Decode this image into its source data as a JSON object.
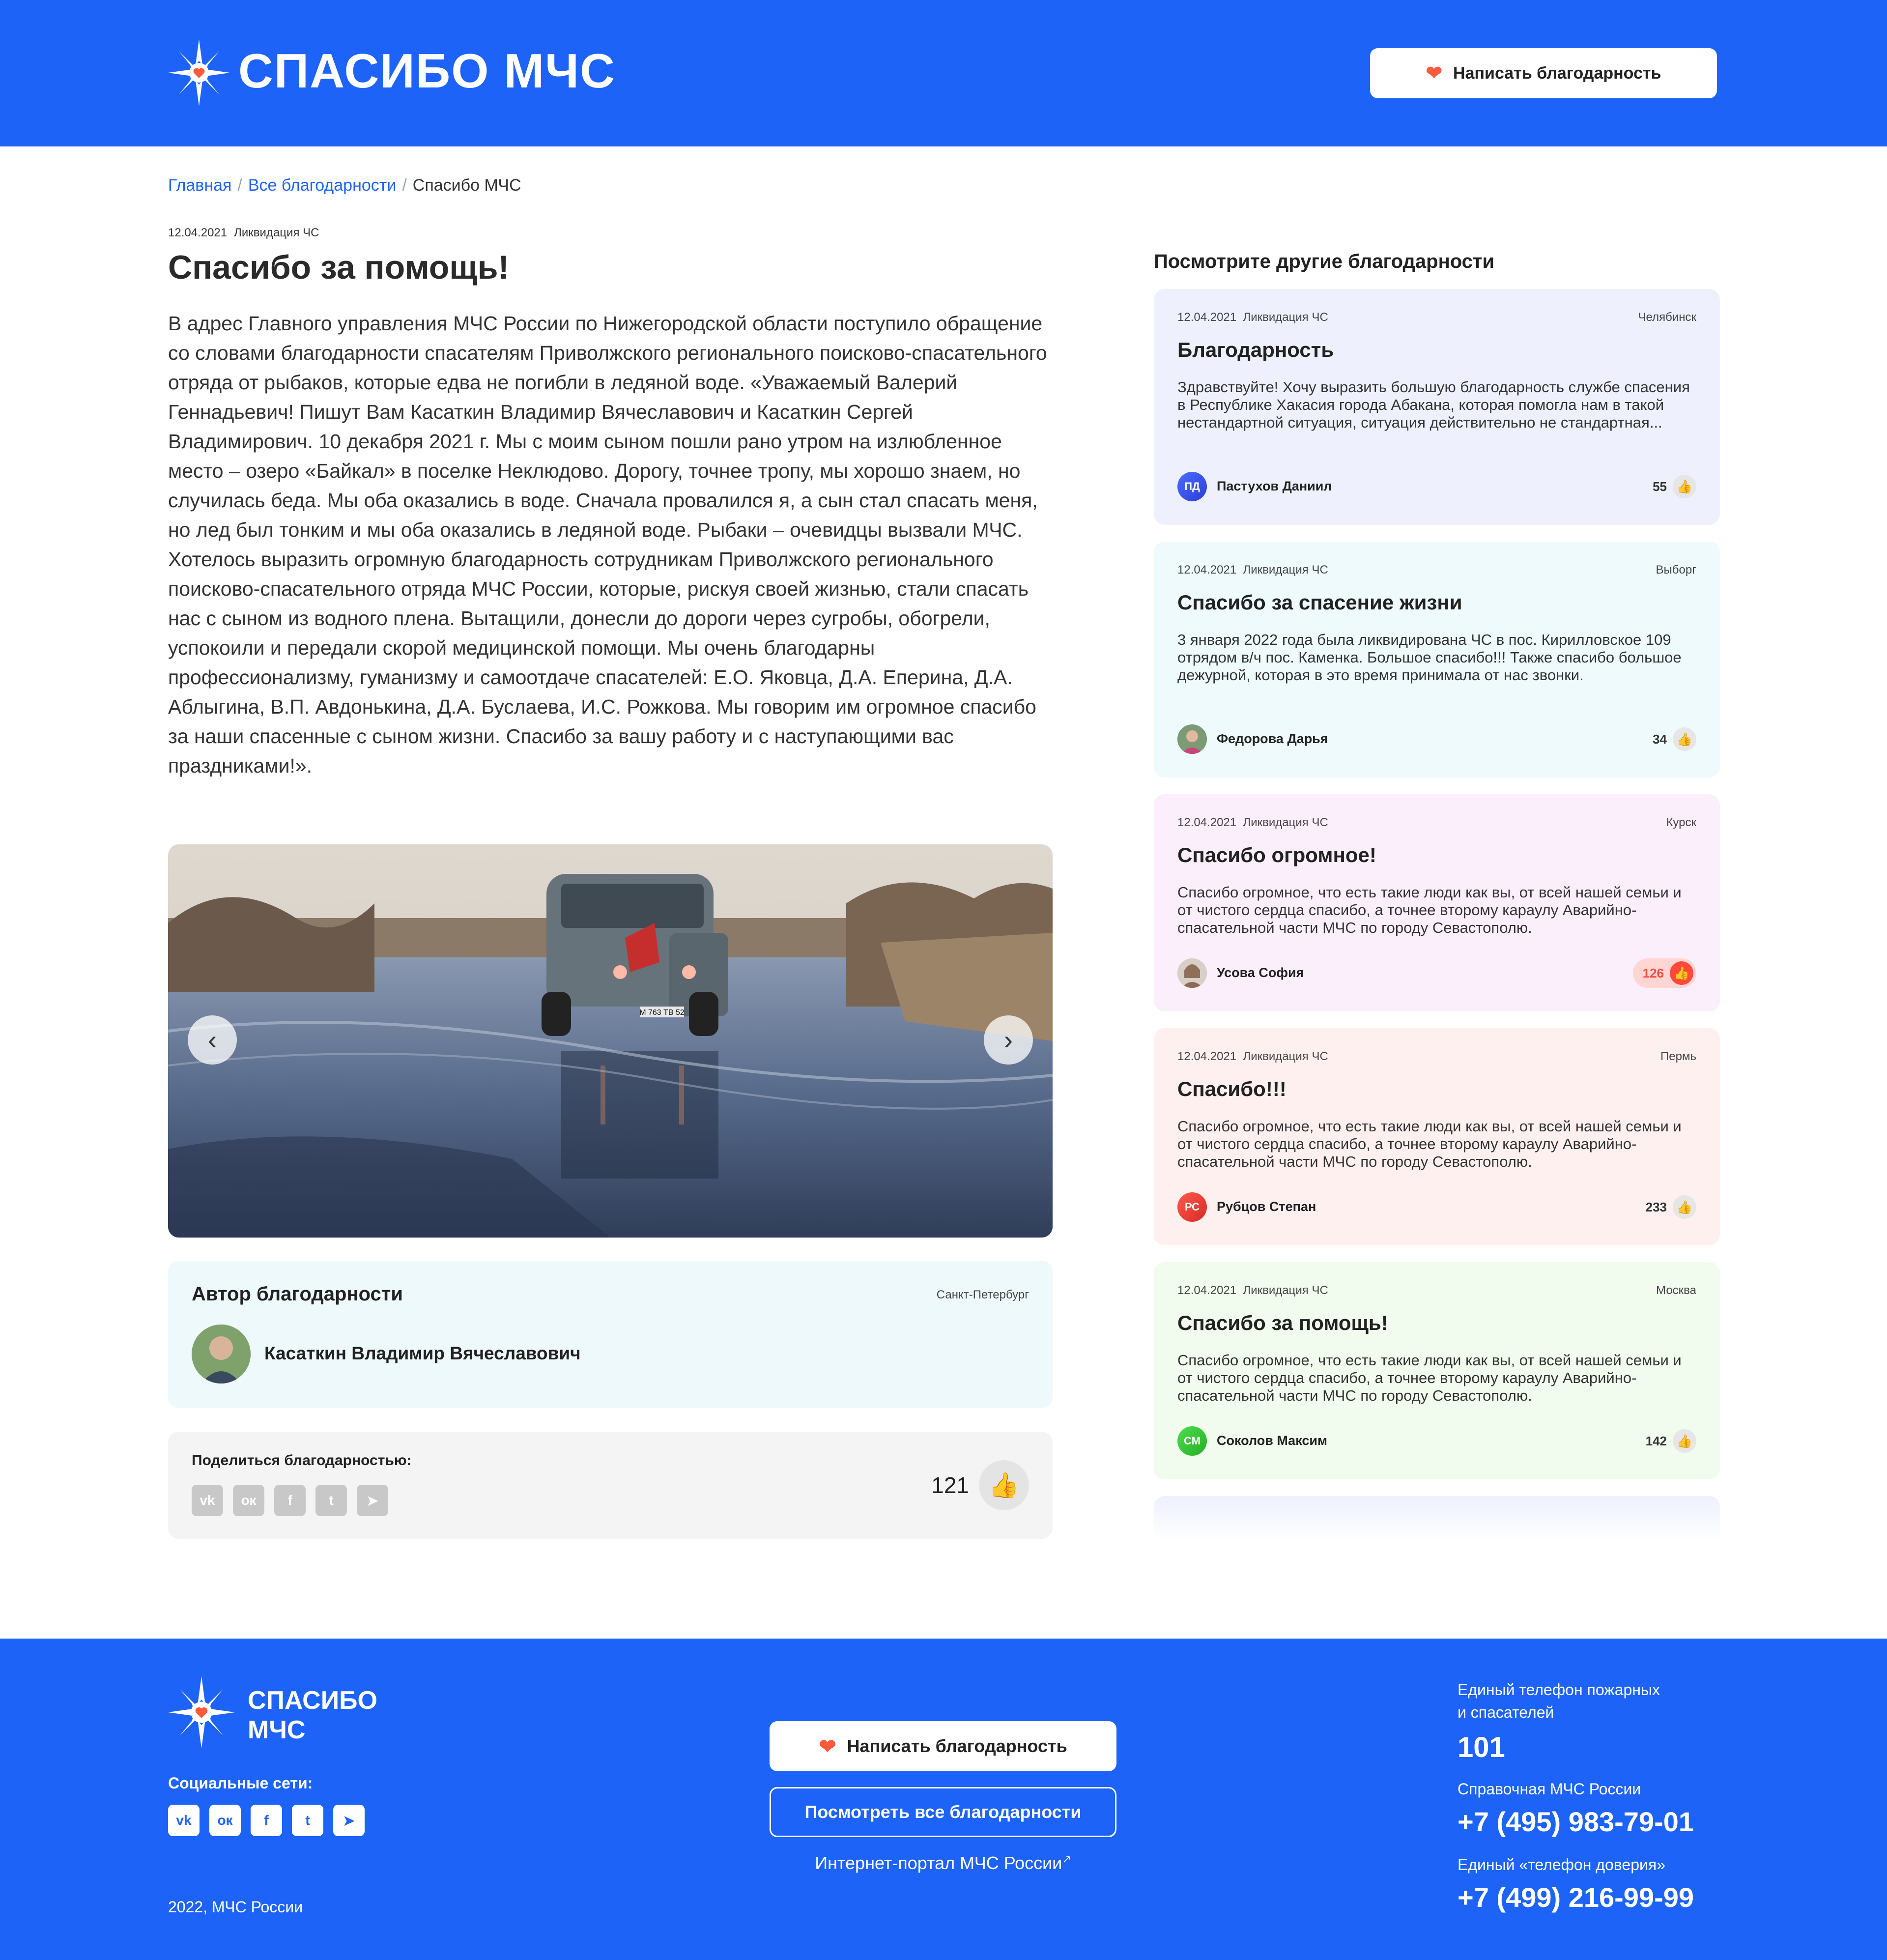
{
  "header": {
    "logo_text": "СПАСИБО МЧС",
    "write_button": "Написать благодарность",
    "heart": "❤"
  },
  "breadcrumb": {
    "home": "Главная",
    "all": "Все благодарности",
    "current": "Спасибо МЧС",
    "separator": "/"
  },
  "article": {
    "date": "12.04.2021",
    "category": "Ликвидация ЧС",
    "title": "Спасибо за помощь!",
    "body": "В адрес Главного управления МЧС России по Нижегородской области поступило обращение со словами благодарности спасателям Приволжского регионального поисково-спасательного отряда от рыбаков, которые едва не погибли в ледяной воде. «Уважаемый Валерий Геннадьевич! Пишут Вам Касаткин Владимир Вячеславович и Касаткин Сергей Владимирович. 10 декабря 2021 г. Мы с моим сыном пошли рано утром на излюбленное место – озеро «Байкал» в поселке Неклюдово. Дорогу, точнее тропу, мы хорошо знаем, но случилась беда. Мы оба оказались в воде. Сначала провалился я, а сын стал спасать меня, но лед был тонким и мы оба оказались в ледяной воде. Рыбаки – очевидцы вызвали МЧС. Хотелось выразить огромную благодарность сотрудникам Приволжского регионального поисково-спасательного отряда МЧС России, которые, рискуя своей жизнью, стали спасать нас с сыном из водного плена. Вытащили, донесли до дороги через сугробы, обогрели, успокоили и передали скорой медицинской помощи. Мы очень благодарны профессионализму, гуманизму и самоотдаче спасателей: Е.О. Яковца, Д.А. Еперина, Д.А. Аблыгина, В.П. Авдонькина, Д.А. Буслаева, И.С. Рожкова. Мы говорим им огромное спасибо за наши спасенные с сыном жизни. Спасибо за вашу работу и с наступающими вас праздниками!».",
    "photo_plate": "М 763 ТВ 52"
  },
  "author": {
    "heading": "Автор благодарности",
    "city": "Санкт-Петербург",
    "name": "Касаткин Владимир Вячеславович"
  },
  "share": {
    "label": "Поделиться благодарностью:",
    "likes": "121",
    "networks": [
      "vk",
      "ok",
      "facebook",
      "twitter",
      "telegram"
    ]
  },
  "sidebar": {
    "title": "Посмотрите другие благодарности",
    "cards": [
      {
        "date": "12.04.2021",
        "category": "Ликвидация ЧС",
        "city": "Челябинск",
        "title": "Благодарность",
        "text": "Здравствуйте! Хочу выразить большую благодарность службе спасения в Республике Хакасия города Абакана, которая помогла нам в такой нестандартной ситуация, ситуация действительно не стандартная...",
        "initials": "ПД",
        "name": "Пастухов Даниил",
        "likes": "55",
        "bg": "#eef1fd"
      },
      {
        "date": "12.04.2021",
        "category": "Ликвидация ЧС",
        "city": "Выборг",
        "title": "Спасибо за спасение жизни",
        "text": "3 января 2022 года была ликвидирована ЧС в пос. Кирилловское 109 отрядом в/ч пос. Каменка. Большое спасибо!!! Также спасибо большое дежурной, которая в это время принимала от нас звонки.",
        "initials": "",
        "name": "Федорова Дарья",
        "likes": "34",
        "bg": "#eefafb"
      },
      {
        "date": "12.04.2021",
        "category": "Ликвидация ЧС",
        "city": "Курск",
        "title": "Спасибо огромное!",
        "text": "Спасибо огромное, что есть такие люди как вы, от всей нашей семьи и от чистого сердца спасибо, а точнее второму караулу Аварийно-спасательной части МЧС по городу Севастополю.",
        "initials": "",
        "name": "Усова София",
        "likes": "126",
        "bg": "#fbeffc"
      },
      {
        "date": "12.04.2021",
        "category": "Ликвидация ЧС",
        "city": "Пермь",
        "title": "Спасибо!!!",
        "text": "Спасибо огромное, что есть такие люди как вы, от всей нашей семьи и от чистого сердца спасибо, а точнее второму караулу Аварийно-спасательной части МЧС по городу Севастополю.",
        "initials": "РС",
        "name": "Рубцов Степан",
        "likes": "233",
        "bg": "#fdf0ef"
      },
      {
        "date": "12.04.2021",
        "category": "Ликвидация ЧС",
        "city": "Москва",
        "title": "Спасибо за помощь!",
        "text": "Спасибо огромное, что есть такие люди как вы, от всей нашей семьи и от чистого сердца спасибо, а точнее второму караулу Аварийно-спасательной части МЧС по городу Севастополю.",
        "initials": "СМ",
        "name": "Соколов Максим",
        "likes": "142",
        "bg": "#f1fbee"
      }
    ]
  },
  "footer": {
    "logo_line1": "СПАСИБО",
    "logo_line2": "МЧС",
    "social_label": "Социальные сети:",
    "copyright": "2022, МЧС России",
    "write_button": "Написать благодарность",
    "all_button": "Посмотреть все благодарности",
    "portal_link": "Интернет-портал МЧС России",
    "phone1_label_line1": "Единый телефон пожарных",
    "phone1_label_line2": "и спасателей",
    "phone1": "101",
    "phone2_label": "Справочная МЧС России",
    "phone2": "+7 (495) 983-79-01",
    "phone3_label": "Единый «телефон доверия»",
    "phone3": "+7 (499) 216-99-99"
  },
  "colors": {
    "brand_blue": "#1d63f8",
    "heart_red": "#ff5a3c",
    "like_active": "#ff4a3a"
  }
}
